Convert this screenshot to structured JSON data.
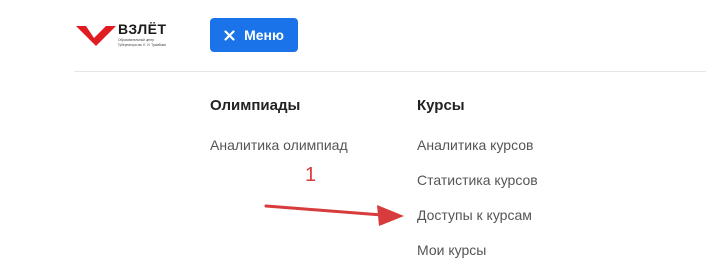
{
  "logo": {
    "title": "ВЗЛЁТ",
    "subtitle_line1": "Образовательный центр",
    "subtitle_line2": "Губернатора им. Е. И. Трамбова",
    "mark_color": "#e01b22",
    "mark_icon": "check-mark-logo-icon"
  },
  "header": {
    "menu_button": {
      "label": "Меню",
      "icon": "close-icon",
      "color": "#1a73e8"
    }
  },
  "menu": {
    "columns": [
      {
        "heading": "Олимпиады",
        "items": [
          "Аналитика олимпиад"
        ]
      },
      {
        "heading": "Курсы",
        "items": [
          "Аналитика курсов",
          "Статистика курсов",
          "Доступы к курсам",
          "Мои курсы"
        ]
      }
    ]
  },
  "annotation": {
    "number": "1",
    "color": "#d83b3b",
    "arrow_icon": "arrow-right-icon"
  }
}
